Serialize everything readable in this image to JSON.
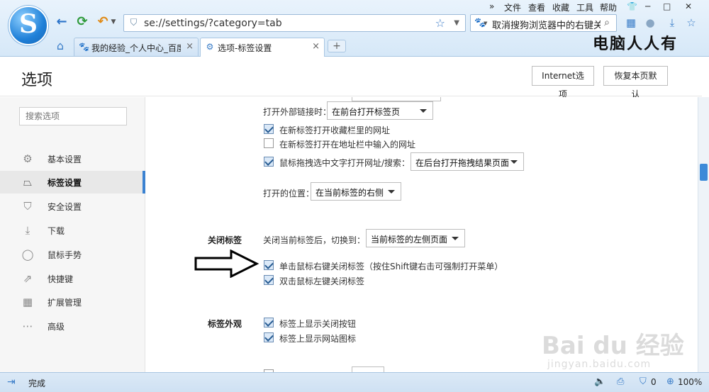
{
  "menu": {
    "overflow": "»",
    "items": [
      "文件",
      "查看",
      "收藏",
      "工具",
      "帮助"
    ]
  },
  "address": {
    "url": "se://settings/?category=tab"
  },
  "search": {
    "text": "取消搜狗浏览器中的右键关闭"
  },
  "tabs": [
    {
      "title": "我的经验_个人中心_百度",
      "icon": "baidu-paw-icon"
    },
    {
      "title": "选项-标签设置",
      "icon": "settings-icon"
    }
  ],
  "new_tab": "+",
  "overlay_text": "电脑人人有",
  "page": {
    "title": "选项",
    "internet_options_button": "Internet选项",
    "restore_defaults_button": "恢复本页默认"
  },
  "sidebar": {
    "search_placeholder": "搜索选项",
    "items": [
      {
        "label": "基本设置",
        "icon": "gear-icon",
        "active": false
      },
      {
        "label": "标签设置",
        "icon": "tab-icon",
        "active": true
      },
      {
        "label": "安全设置",
        "icon": "shield-icon",
        "active": false
      },
      {
        "label": "下载",
        "icon": "download-icon",
        "active": false
      },
      {
        "label": "鼠标手势",
        "icon": "mouse-icon",
        "active": false
      },
      {
        "label": "快捷键",
        "icon": "shortcut-icon",
        "active": false
      },
      {
        "label": "扩展管理",
        "icon": "extensions-icon",
        "active": false
      },
      {
        "label": "高级",
        "icon": "more-icon",
        "active": false
      }
    ]
  },
  "settings": {
    "external_link": {
      "label": "打开外部链接时：",
      "value": "在前台打开标签页"
    },
    "open_fav_in_new_tab": {
      "label": "在新标签打开收藏栏里的网址",
      "checked": true
    },
    "open_addr_in_new_tab": {
      "label": "在新标签打开在地址栏中输入的网址",
      "checked": false
    },
    "drag_text_open": {
      "label": "鼠标拖拽选中文字打开网址/搜索：",
      "checked": true,
      "value": "在后台打开拖拽结果页面"
    },
    "open_position": {
      "label": "打开的位置：",
      "value": "在当前标签的右侧"
    },
    "close_tab": {
      "section": "关闭标签",
      "switch_label": "关闭当前标签后，切换到：",
      "switch_value": "当前标签的左侧页面",
      "right_click_close": {
        "label": "单击鼠标右键关闭标签（按住Shift键右击可强制打开菜单）",
        "checked": true
      },
      "double_click_close": {
        "label": "双击鼠标左键关闭标签",
        "checked": true
      }
    },
    "tab_appearance": {
      "section": "标签外观",
      "show_close_button": {
        "label": "标签上显示关闭按钮",
        "checked": true
      },
      "show_site_icon": {
        "label": "标签上显示网站图标",
        "checked": true
      }
    }
  },
  "statusbar": {
    "text": "完成",
    "count": "0",
    "zoom": "100%"
  },
  "watermark": {
    "main": "Bai du 经验",
    "sub": "jingyan.baidu.com"
  }
}
